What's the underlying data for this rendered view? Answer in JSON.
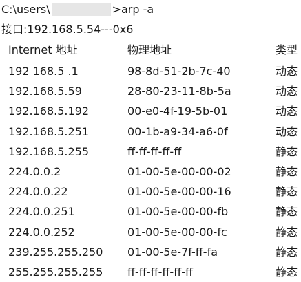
{
  "console": {
    "prompt_path": "C:\\users\\",
    "prompt_command": ">arp -a",
    "interface_label": "接口:",
    "interface_value": "192.168.5.54---0x6",
    "columns": {
      "ip": "Internet 地址",
      "mac": "物理地址",
      "type": "类型"
    },
    "rows": [
      {
        "ip": "192 168.5 .1",
        "mac": "98-8d-51-2b-7c-40",
        "type": "动态"
      },
      {
        "ip": "192.168.5.59",
        "mac": "28-80-23-11-8b-5a",
        "type": "动态"
      },
      {
        "ip": "192.168.5.192",
        "mac": "00-e0-4f-19-5b-01",
        "type": "动态"
      },
      {
        "ip": "192.168.5.251",
        "mac": "00-1b-a9-34-a6-0f",
        "type": "动态"
      },
      {
        "ip": "192.168.5.255",
        "mac": "ff-ff-ff-ff-ff",
        "type": "静态"
      },
      {
        "ip": "224.0.0.2",
        "mac": "01-00-5e-00-00-02",
        "type": "静态"
      },
      {
        "ip": "224.0.0.22",
        "mac": "01-00-5e-00-00-16",
        "type": "静态"
      },
      {
        "ip": "224.0.0.251",
        "mac": "01-00-5e-00-00-fb",
        "type": "静态"
      },
      {
        "ip": "224.0.0.252",
        "mac": "01-00-5e-00-00-fc",
        "type": "静态"
      },
      {
        "ip": "239.255.255.250",
        "mac": "01-00-5e-7f-ff-fa",
        "type": "静态"
      },
      {
        "ip": "255.255.255.255",
        "mac": "ff-ff-ff-ff-ff-ff",
        "type": "静态"
      }
    ]
  }
}
